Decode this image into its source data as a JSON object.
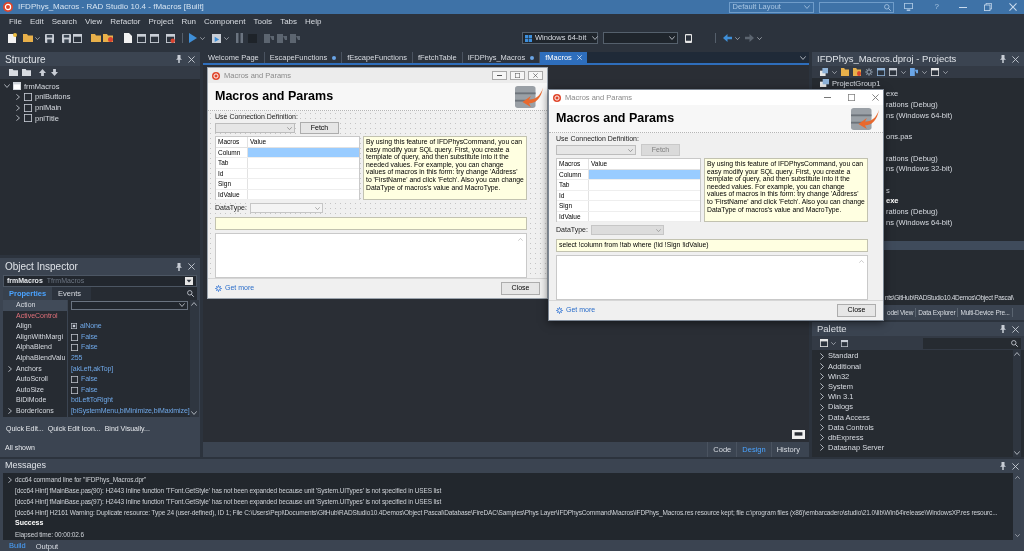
{
  "window": {
    "title": "IFDPhys_Macros - RAD Studio 10.4 - fMacros [Built]",
    "layout": "Default Layout",
    "help": "?"
  },
  "menu": [
    "File",
    "Edit",
    "Search",
    "View",
    "Refactor",
    "Project",
    "Run",
    "Component",
    "Tools",
    "Tabs",
    "Help"
  ],
  "toolbar": {
    "platform": "Windows 64-bit"
  },
  "structure": {
    "title": "Structure",
    "tree": [
      {
        "label": "frmMacros",
        "expanded": true,
        "children": [
          {
            "label": "pnlButtons",
            "expanded": false
          },
          {
            "label": "pnlMain",
            "expanded": false
          },
          {
            "label": "pnlTitle",
            "expanded": false
          }
        ]
      }
    ]
  },
  "object_inspector": {
    "title": "Object Inspector",
    "object": "frmMacros",
    "class": "TfrmMacros",
    "tabs": [
      {
        "label": "Properties",
        "selected": true
      },
      {
        "label": "Events",
        "selected": false
      }
    ],
    "properties": [
      {
        "name": "Action",
        "kind": "combo",
        "selected": true
      },
      {
        "name": "ActiveControl",
        "kind": "reference",
        "selected": false
      },
      {
        "name": "Align",
        "kind": "enum",
        "value": "alNone",
        "selected": false
      },
      {
        "name": "AlignWithMargi",
        "kind": "bool",
        "value": "False",
        "selected": false
      },
      {
        "name": "AlphaBlend",
        "kind": "bool",
        "value": "False",
        "selected": false
      },
      {
        "name": "AlphaBlendValu",
        "kind": "text",
        "value": "255",
        "selected": false
      },
      {
        "name": "Anchors",
        "kind": "set",
        "value": "[akLeft,akTop]",
        "selected": false
      },
      {
        "name": "AutoScroll",
        "kind": "bool",
        "value": "False",
        "selected": false
      },
      {
        "name": "AutoSize",
        "kind": "bool",
        "value": "False",
        "selected": false
      },
      {
        "name": "BiDiMode",
        "kind": "text",
        "value": "bdLeftToRight",
        "selected": false
      },
      {
        "name": "BorderIcons",
        "kind": "set",
        "value": "[biSystemMenu,biMinimize,biMaximize]",
        "selected": false
      }
    ],
    "actions": [
      "Quick Edit...",
      "Quick Edit Icon...",
      "Bind Visually..."
    ],
    "status": "All shown"
  },
  "editor": {
    "tabs": [
      {
        "label": "Welcome Page",
        "selected": false,
        "modified": false
      },
      {
        "label": "EscapeFunctions",
        "selected": false,
        "modified": true
      },
      {
        "label": "fEscapeFunctions",
        "selected": false,
        "modified": false
      },
      {
        "label": "fFetchTable",
        "selected": false,
        "modified": false
      },
      {
        "label": "IFDPhys_Macros",
        "selected": false,
        "modified": true
      },
      {
        "label": "fMacros",
        "selected": true,
        "modified": false
      }
    ],
    "views": [
      {
        "label": "Code",
        "selected": false
      },
      {
        "label": "Design",
        "selected": true
      },
      {
        "label": "History",
        "selected": false
      }
    ]
  },
  "design_form": {
    "title": "Macros and Params",
    "heading": "Macros and Params",
    "connection_label": "Use Connection Definition:",
    "fetch": {
      "label": "Fetch",
      "disabled": false
    },
    "columns": [
      "Macros",
      "Value"
    ],
    "macros": [
      {
        "name": "Column",
        "selected": true
      },
      {
        "name": "Tab",
        "selected": false
      },
      {
        "name": "Id",
        "selected": false
      },
      {
        "name": "Sign",
        "selected": false
      },
      {
        "name": "IdValue",
        "selected": false
      }
    ],
    "info": "By using this feature of IFDPhysCommand, you can easy modify your SQL query. First, you create a template of query, and then substitute into it the needed values. For example, you can change values of macros in this form: try change 'Address' to 'FirstName' and click 'Fetch'. Also you can change DataType of macros's value and MacroType.",
    "datatype": {
      "label": "DataType:",
      "disabled": false
    },
    "link": "Get more",
    "close": "Close"
  },
  "running_form": {
    "title": "Macros and Params",
    "heading": "Macros and Params",
    "connection_label": "Use Connection Definition:",
    "fetch": {
      "label": "Fetch",
      "disabled": true
    },
    "columns": [
      "Macros",
      "Value"
    ],
    "macros": [
      {
        "name": "Column",
        "selected": true
      },
      {
        "name": "Tab",
        "selected": false
      },
      {
        "name": "Id",
        "selected": false
      },
      {
        "name": "Sign",
        "selected": false
      },
      {
        "name": "IdValue",
        "selected": false
      }
    ],
    "info": "By using this feature of IFDPhysCommand, you can easy modify your SQL query. First, you create a template of query, and then substitute into it the needed values. For example, you can change values of macros in this form: try change 'Address' to 'FirstName' and click 'Fetch'. Also you can change DataType of macros's value and MacroType.",
    "datatype": {
      "label": "DataType:",
      "disabled": true
    },
    "sql": "select !column from !tab where (!id !Sign !idValue)",
    "link": "Get more",
    "close": "Close"
  },
  "projects": {
    "title": "IFDPhys_Macros.dproj - Projects",
    "tree": [
      {
        "label": "ProjectGroup1",
        "active": false,
        "children": [
          {
            "label": "exe",
            "active": false
          },
          {
            "label": "rations (Debug)",
            "active": false
          },
          {
            "label": "ns (Windows 64-bit)",
            "active": false
          },
          {
            "label": "ons.pas",
            "active": false
          },
          {
            "label": "rations (Debug)",
            "active": false
          },
          {
            "label": "ns (Windows 32-bit)",
            "active": false
          },
          {
            "label": "s",
            "active": false
          },
          {
            "label": "exe",
            "active": true
          },
          {
            "label": "rations (Debug)",
            "active": false
          },
          {
            "label": "ns (Windows 64-bit)",
            "active": false
          }
        ]
      }
    ],
    "path": "nts\\GitHub\\RADStudio10.4Demos\\Object Pascal\\",
    "tabs": [
      {
        "label": "odel View",
        "selected": false
      },
      {
        "label": "Data Explorer",
        "selected": false
      },
      {
        "label": "Multi-Device Pre...",
        "selected": false
      }
    ]
  },
  "palette": {
    "title": "Palette",
    "categories": [
      "Standard",
      "Additional",
      "Win32",
      "System",
      "Win 3.1",
      "Dialogs",
      "Data Access",
      "Data Controls",
      "dbExpress",
      "Datasnap Server"
    ]
  },
  "messages": {
    "title": "Messages",
    "lines": [
      {
        "kind": "group",
        "text": "dcc64 command line for \"IFDPhys_Macros.dpr\""
      },
      {
        "kind": "hint",
        "text": "[dcc64 Hint] fMainBase.pas(90): H2443 Inline function 'TFont.GetStyle' has not been expanded because unit 'System.UITypes' is not specified in USES list"
      },
      {
        "kind": "hint",
        "text": "[dcc64 Hint] fMainBase.pas(97): H2443 Inline function 'TFont.GetStyle' has not been expanded because unit 'System.UITypes' is not specified in USES list"
      },
      {
        "kind": "hint",
        "text": "[dcc64 Hint] H2161 Warning: Duplicate resource:  Type 24 (user-defined), ID 1; File C:\\Users\\Pepi\\Documents\\GitHub\\RADStudio10.4Demos\\Object Pascal\\Database\\FireDAC\\Samples\\Phys Layer\\IFDPhysCommand\\Macros\\IFDPhys_Macros.res resource kept; file c:\\program files (x86)\\embarcadero\\studio\\21.0\\lib\\Win64\\release\\WindowsXP.res resourc..."
      },
      {
        "kind": "success",
        "text": "Success"
      },
      {
        "kind": "info",
        "text": "Elapsed time: 00:00:02.6"
      }
    ],
    "tabs": [
      {
        "label": "Build",
        "selected": true
      },
      {
        "label": "Output",
        "selected": false
      }
    ]
  }
}
